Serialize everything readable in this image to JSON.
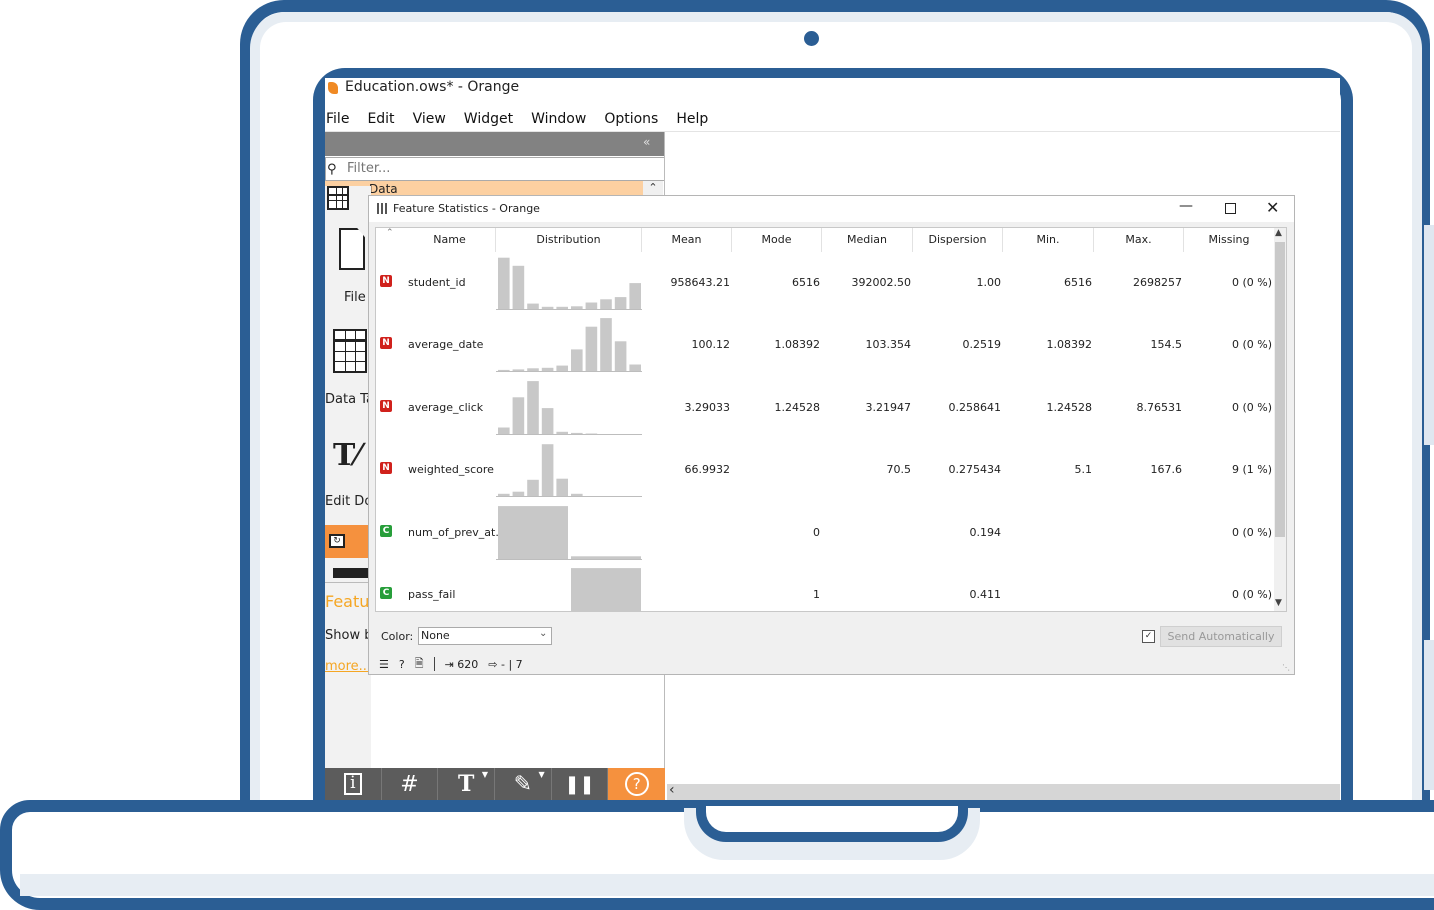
{
  "app": {
    "title": "Education.ows* - Orange",
    "menu": [
      "File",
      "Edit",
      "View",
      "Widget",
      "Window",
      "Options",
      "Help"
    ]
  },
  "toolbox": {
    "collapse_glyph": "«",
    "filter_placeholder": "Filter...",
    "category": "Data",
    "widgets": [
      {
        "label": "File",
        "icon": "file-icon"
      },
      {
        "label": "Data Table",
        "icon": "data-table-icon"
      },
      {
        "label": "Edit Domain",
        "icon": "edit-domain-icon"
      }
    ],
    "help": {
      "title": "Feature Statistics",
      "description": "Show basic statistics for data features.",
      "more": "more..."
    },
    "bottom_buttons": [
      {
        "name": "info-icon",
        "glyph": "🛈"
      },
      {
        "name": "grid-icon",
        "glyph": "#"
      },
      {
        "name": "text-icon",
        "glyph": "T"
      },
      {
        "name": "pen-icon",
        "glyph": "✎"
      },
      {
        "name": "pause-icon",
        "glyph": "❚❚"
      },
      {
        "name": "help-icon",
        "glyph": "?"
      }
    ]
  },
  "feature_statistics": {
    "window_title": "Feature Statistics - Orange",
    "columns": [
      "Name",
      "Distribution",
      "Mean",
      "Mode",
      "Median",
      "Dispersion",
      "Min.",
      "Max.",
      "Missing"
    ],
    "rows": [
      {
        "type": "N",
        "name": "student_id",
        "mean": "958643.21",
        "mode": "6516",
        "median": "392002.50",
        "dispersion": "1.00",
        "min": "6516",
        "max": "2698257",
        "missing": "0 (0 %)",
        "hist": [
          0.95,
          0.8,
          0.1,
          0.04,
          0.04,
          0.05,
          0.12,
          0.18,
          0.22,
          0.48
        ]
      },
      {
        "type": "N",
        "name": "average_date",
        "mean": "100.12",
        "mode": "1.08392",
        "median": "103.354",
        "dispersion": "0.2519",
        "min": "1.08392",
        "max": "154.5",
        "missing": "0 (0 %)",
        "hist": [
          0.02,
          0.03,
          0.05,
          0.06,
          0.1,
          0.4,
          0.82,
          0.98,
          0.55,
          0.12
        ]
      },
      {
        "type": "N",
        "name": "average_click",
        "mean": "3.29033",
        "mode": "1.24528",
        "median": "3.21947",
        "dispersion": "0.258641",
        "min": "1.24528",
        "max": "8.76531",
        "missing": "0 (0 %)",
        "hist": [
          0.12,
          0.68,
          0.98,
          0.48,
          0.04,
          0.02,
          0.01,
          0.0,
          0.0,
          0.0
        ]
      },
      {
        "type": "N",
        "name": "weighted_score",
        "mean": "66.9932",
        "mode": "",
        "median": "70.5",
        "dispersion": "0.275434",
        "min": "5.1",
        "max": "167.6",
        "missing": "9 (1 %)",
        "hist": [
          0.04,
          0.08,
          0.3,
          0.96,
          0.32,
          0.04,
          0.0,
          0.0,
          0.0,
          0.0
        ]
      },
      {
        "type": "C",
        "name": "num_of_prev_at...",
        "mean": "",
        "mode": "0",
        "median": "",
        "dispersion": "0.194",
        "min": "",
        "max": "",
        "missing": "0 (0 %)",
        "hist": [
          0.98,
          0.05
        ]
      },
      {
        "type": "C",
        "name": "pass_fail",
        "mean": "",
        "mode": "1",
        "median": "",
        "dispersion": "0.411",
        "min": "",
        "max": "",
        "missing": "0 (0 %)",
        "hist": [
          0.0,
          0.98
        ]
      }
    ],
    "color_label": "Color:",
    "color_value": "None",
    "auto_send_checked": true,
    "send_label": "Send Automatically",
    "status": {
      "input": "620",
      "output": "- | 7"
    }
  },
  "colors": {
    "accent": "#f5913e",
    "laptop": "#2b5e94",
    "numeric_badge": "#d0211c",
    "categorical_badge": "#279e3a",
    "bar": "#c8c8c8"
  }
}
